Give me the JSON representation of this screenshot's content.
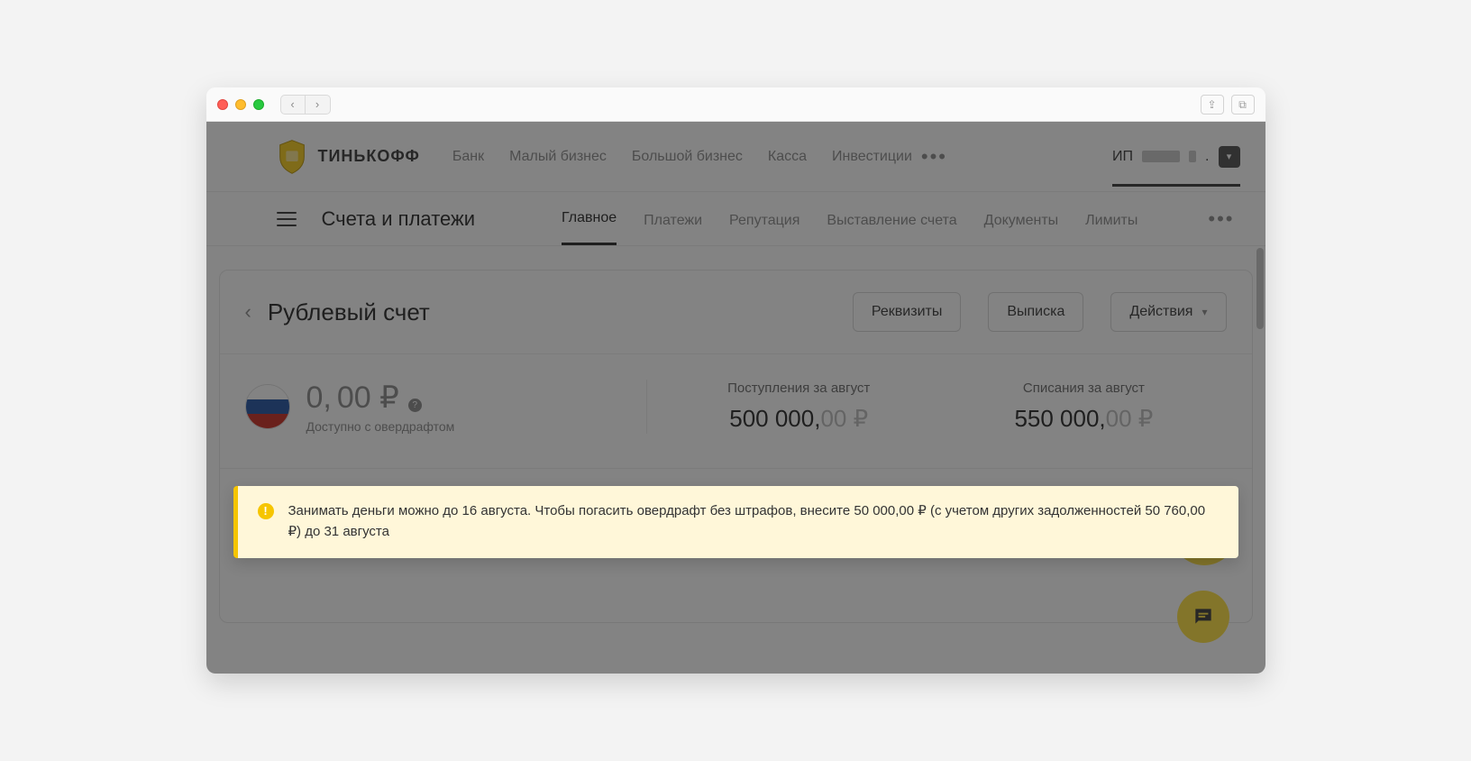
{
  "colors": {
    "accent_yellow": "#ffe13a",
    "warn_border": "#f6c500",
    "warn_bg": "#fff7d9"
  },
  "window": {
    "title_icons": {
      "back": "‹",
      "forward": "›",
      "share": "⇪",
      "copy": "⧉"
    }
  },
  "brand": {
    "name": "ТИНЬКОФФ"
  },
  "topnav": {
    "items": [
      "Банк",
      "Малый бизнес",
      "Большой бизнес",
      "Касса",
      "Инвестиции"
    ],
    "more_glyph": "•••",
    "account_prefix": "ИП",
    "account_suffix": "."
  },
  "secondbar": {
    "title": "Счета и платежи",
    "tabs": [
      "Главное",
      "Платежи",
      "Репутация",
      "Выставление счета",
      "Документы",
      "Лимиты"
    ],
    "active_index": 0,
    "more_glyph": "•••"
  },
  "account_card": {
    "back_glyph": "‹",
    "title": "Рублевый счет",
    "buttons": {
      "requisites": "Реквизиты",
      "statement": "Выписка",
      "actions": "Действия"
    },
    "balance": {
      "int": "0,",
      "decim": "00 ₽",
      "help_glyph": "?",
      "sub": "Доступно с овердрафтом"
    },
    "inflow": {
      "label": "Поступления за август",
      "int": "500 000,",
      "decim": "00 ₽"
    },
    "outflow": {
      "label": "Списания за август",
      "int": "550 000,",
      "decim": "00 ₽"
    }
  },
  "alert": {
    "icon_glyph": "!",
    "text": "Занимать деньги можно до 16 августа. Чтобы погасить овердрафт без штрафов, внесите 50 000,00 ₽ (с учетом других задолженностей 50 760,00 ₽) до 31 августа"
  },
  "chat_fab": {
    "name": "chat"
  }
}
